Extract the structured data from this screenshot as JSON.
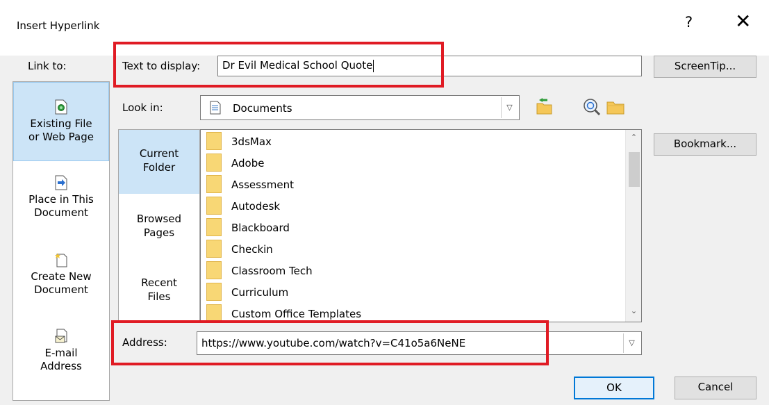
{
  "dialog": {
    "title": "Insert Hyperlink",
    "help_glyph": "?",
    "close_glyph": "✕"
  },
  "link_to": {
    "label": "Link to:",
    "items": [
      {
        "line1": "Existing File",
        "line2": "or Web Page",
        "icon": "existing-file-icon"
      },
      {
        "line1": "Place in This",
        "line2": "Document",
        "icon": "place-in-document-icon"
      },
      {
        "line1": "Create New",
        "line2": "Document",
        "icon": "new-document-icon"
      },
      {
        "line1": "E-mail",
        "line2": "Address",
        "icon": "email-icon"
      }
    ]
  },
  "text_to_display": {
    "label": "Text to display:",
    "value": "Dr Evil Medical School Quote"
  },
  "buttons": {
    "screentip": "ScreenTip...",
    "bookmark": "Bookmark...",
    "ok": "OK",
    "cancel": "Cancel"
  },
  "look_in": {
    "label": "Look in:",
    "value": "Documents"
  },
  "places": [
    {
      "line1": "Current",
      "line2": "Folder"
    },
    {
      "line1": "Browsed",
      "line2": "Pages"
    },
    {
      "line1": "Recent",
      "line2": "Files"
    }
  ],
  "files": [
    "3dsMax",
    "Adobe",
    "Assessment",
    "Autodesk",
    "Blackboard",
    "Checkin",
    "Classroom Tech",
    "Curriculum",
    "Custom Office Templates"
  ],
  "address": {
    "label": "Address:",
    "value": "https://www.youtube.com/watch?v=C41o5a6NeNE"
  },
  "colors": {
    "highlight_box": "#e01b24",
    "selection": "#cce4f7",
    "default_button_border": "#0078d7"
  }
}
